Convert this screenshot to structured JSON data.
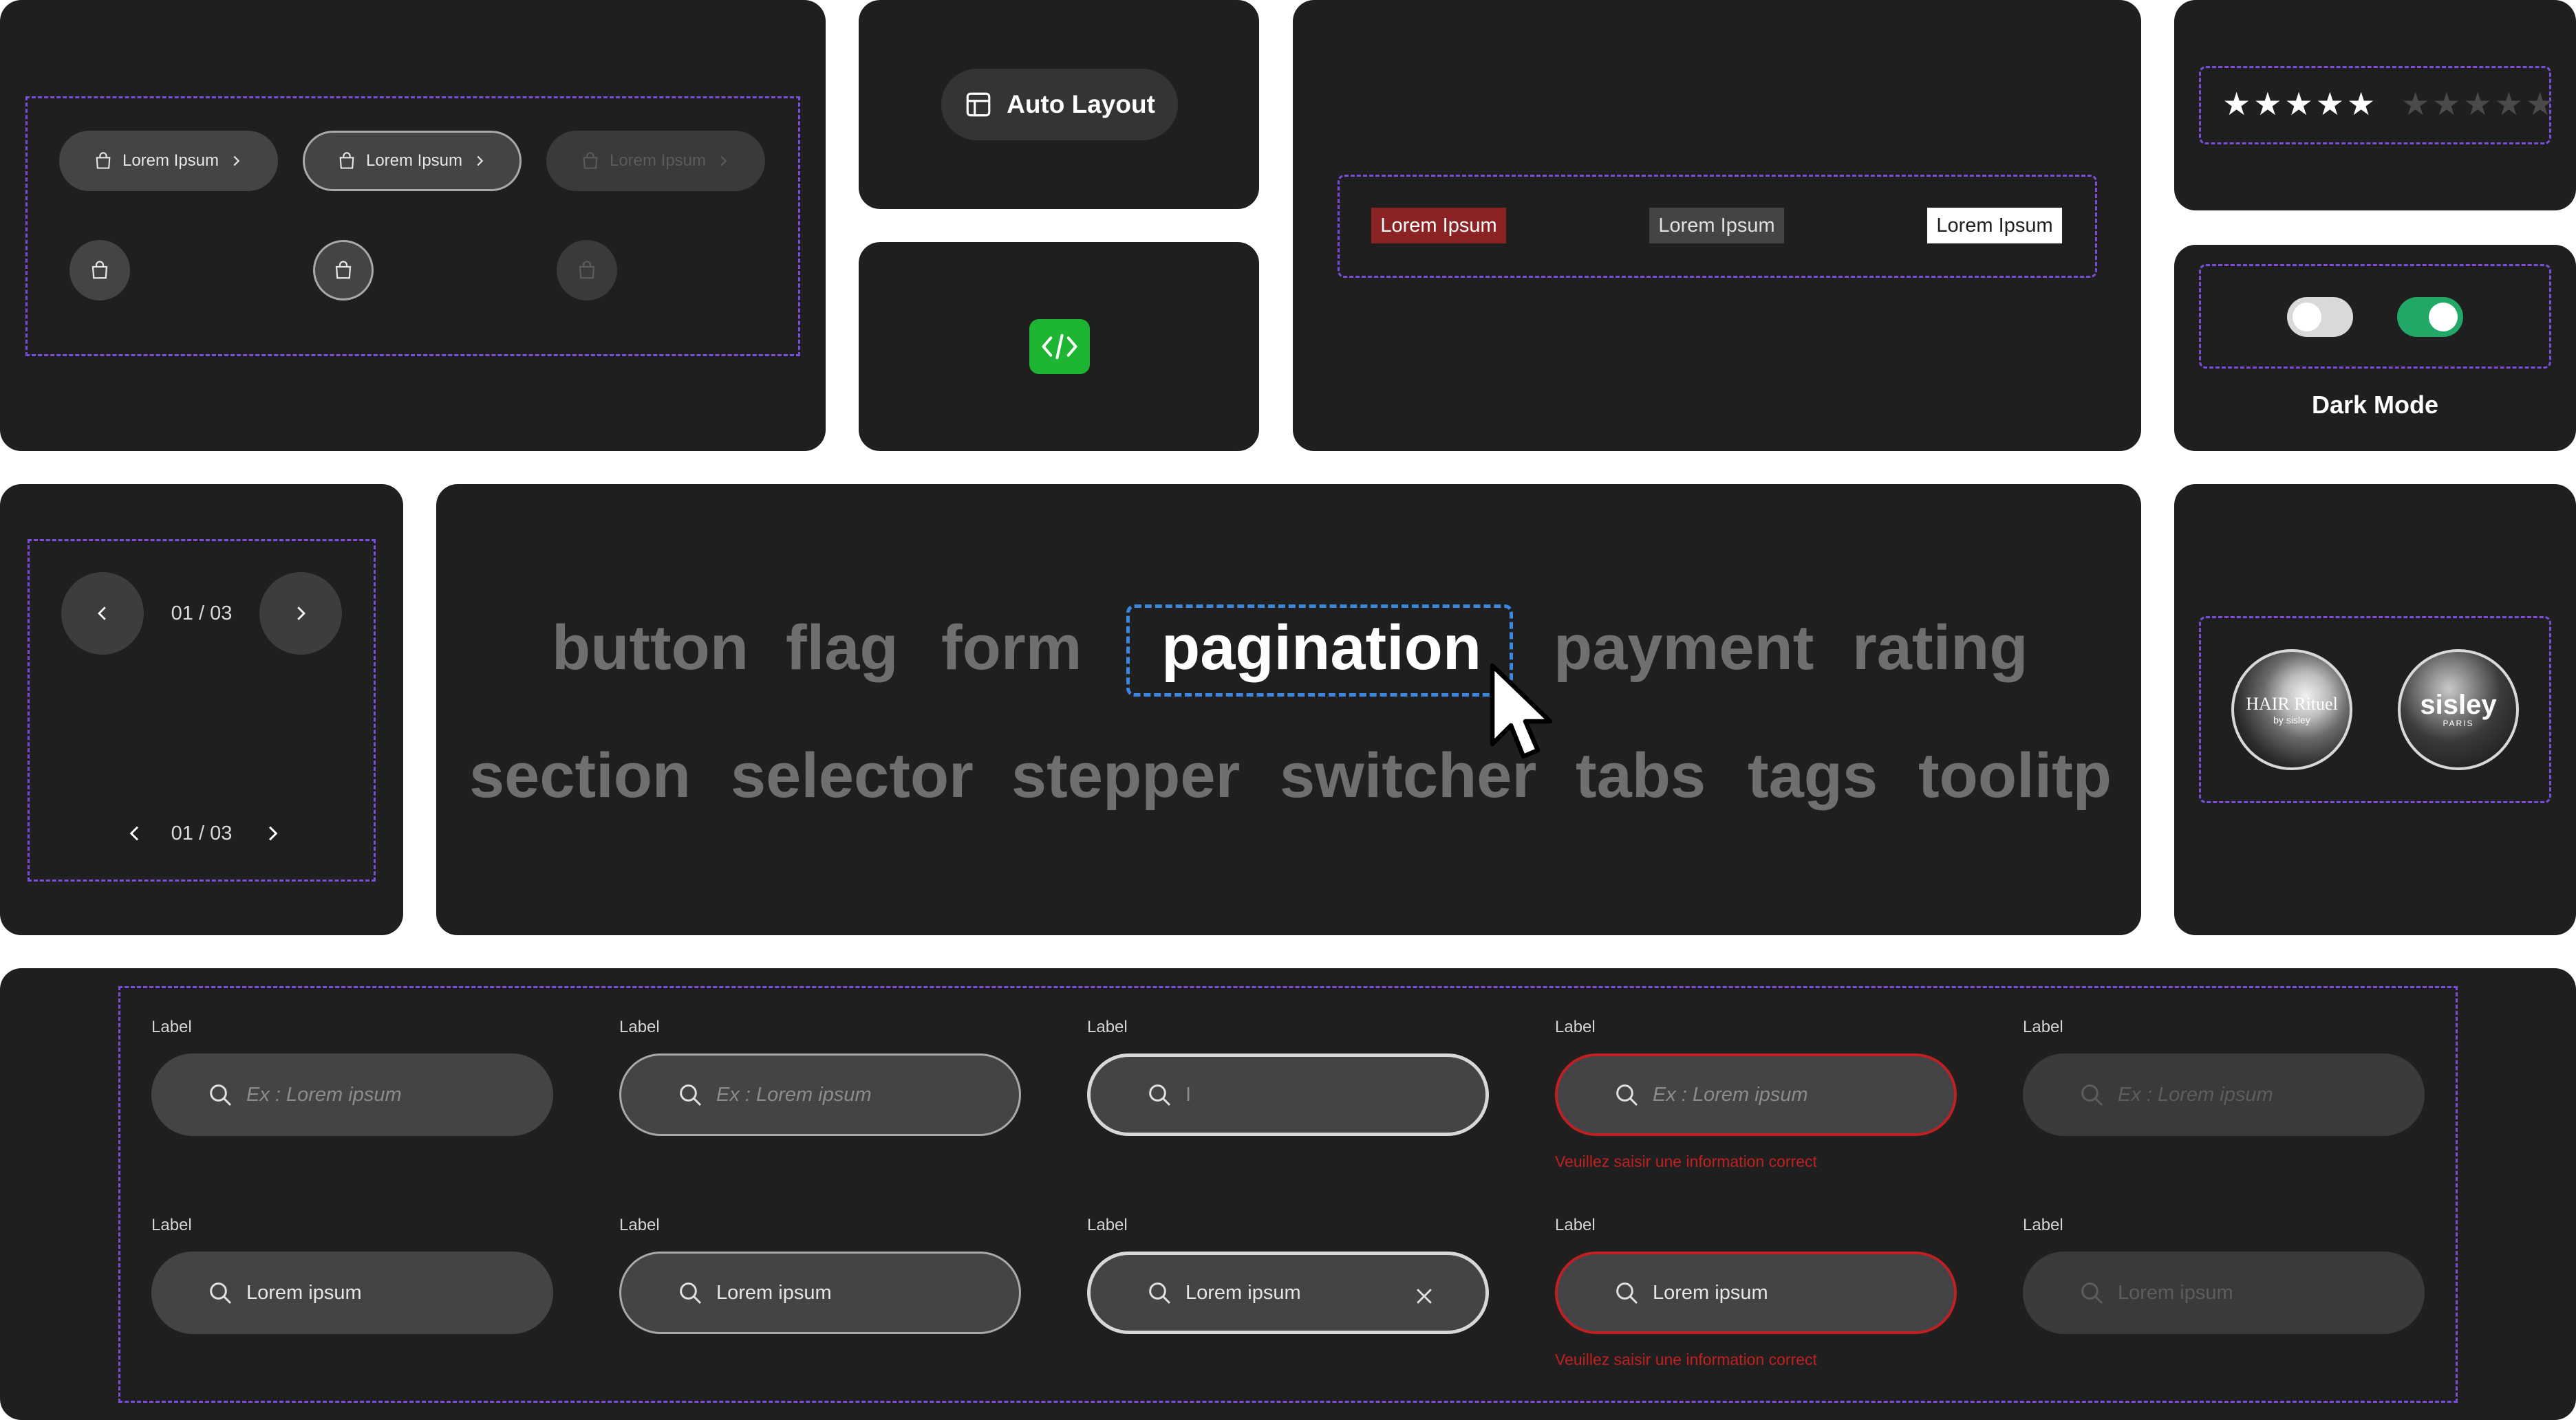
{
  "buttons_card": {
    "pill_buttons": [
      {
        "label": "Lorem Ipsum",
        "state": "default"
      },
      {
        "label": "Lorem Ipsum",
        "state": "outlined"
      },
      {
        "label": "Lorem Ipsum",
        "state": "disabled"
      }
    ],
    "icon_buttons": [
      "shopping-bag-icon",
      "shopping-bag-icon",
      "shopping-bag-icon"
    ]
  },
  "auto_layout": {
    "label": "Auto Layout",
    "icon": "layout-icon"
  },
  "code_badge": {
    "icon": "code-icon",
    "color": "#1db531"
  },
  "flags": [
    {
      "label": "Lorem Ipsum",
      "bg": "#8b2325",
      "fg": "#ffffff"
    },
    {
      "label": "Lorem Ipsum",
      "bg": "#444446",
      "fg": "#e0e0e0"
    },
    {
      "label": "Lorem Ipsum",
      "bg": "#ffffff",
      "fg": "#1f1f20"
    }
  ],
  "rating": {
    "filled": "★★★★★",
    "empty": "★★★★★",
    "filled_value": 5,
    "max": 5
  },
  "switches": {
    "label": "Dark Mode",
    "off_color": "#d9d9d9",
    "on_color": "#21a866"
  },
  "pagination_card": {
    "counter_large": "01 / 03",
    "counter_small": "01 / 03"
  },
  "components": {
    "row1": [
      "button",
      "flag",
      "form",
      "pagination",
      "payment",
      "rating"
    ],
    "row2": [
      "section",
      "selector",
      "stepper",
      "switcher",
      "tabs",
      "tags",
      "toolitp"
    ],
    "active": "pagination"
  },
  "avatars": [
    {
      "brand": "HAIR Rituel",
      "sub": "by sisley"
    },
    {
      "brand": "sisley",
      "sub": "PARIS"
    }
  ],
  "inputs": {
    "label": "Label",
    "placeholder": "Ex : Lorem ipsum",
    "typing_value": "I",
    "value": "Lorem ipsum",
    "error_message": "Veuillez saisir une information correct",
    "colors": {
      "error": "#c0201f",
      "field": "#444446"
    }
  }
}
